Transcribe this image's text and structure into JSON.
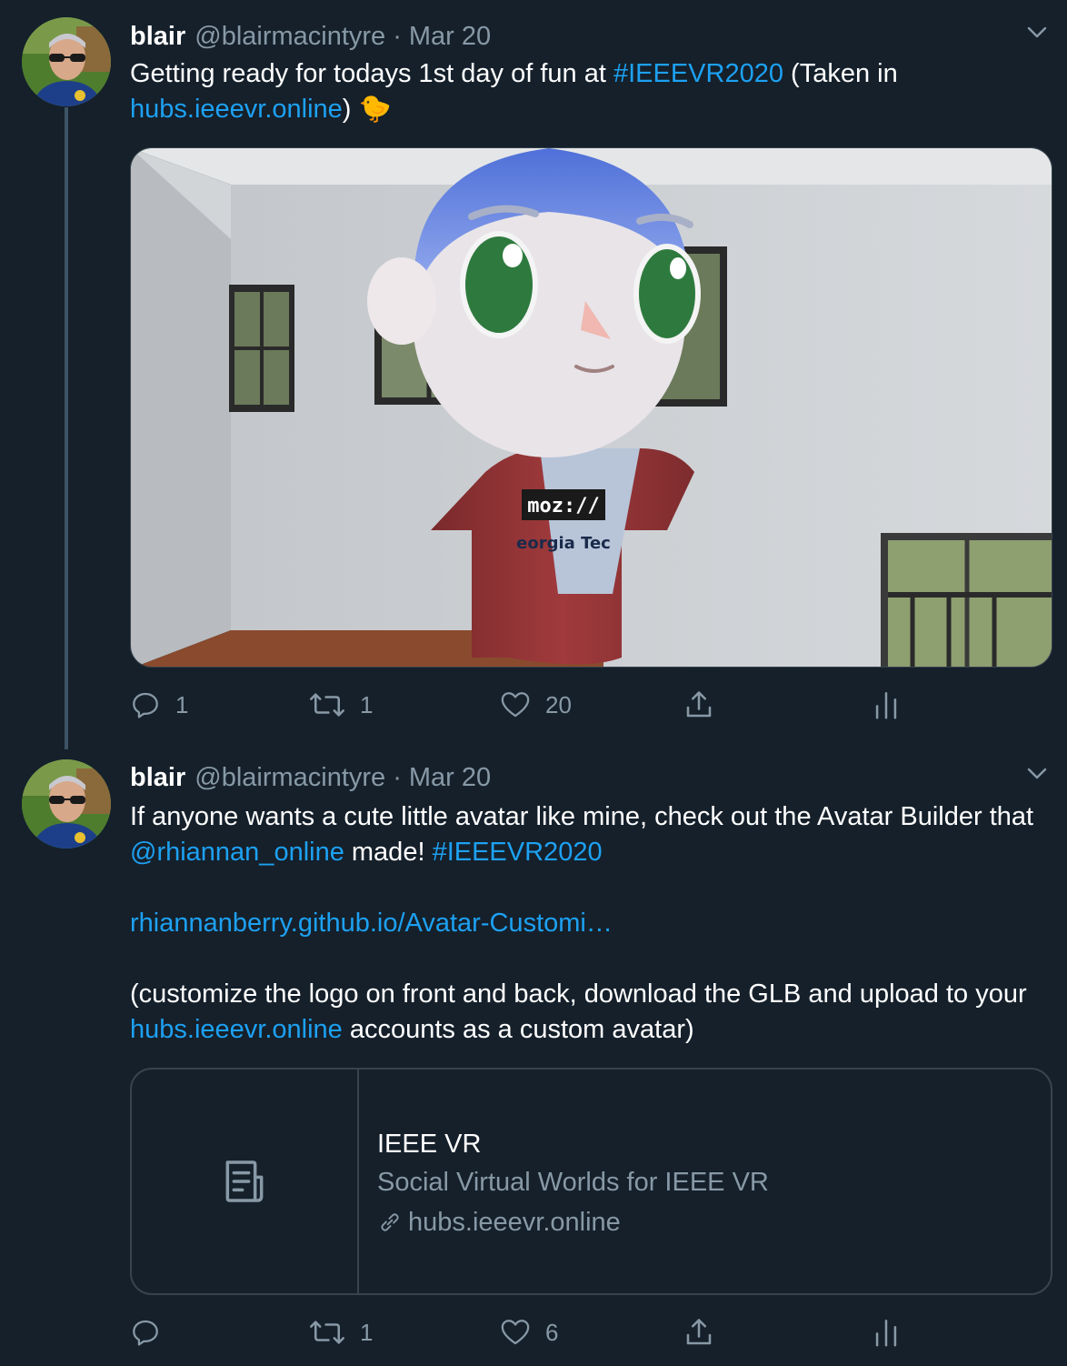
{
  "tweets": [
    {
      "author": {
        "name": "blair",
        "handle": "@blairmacintyre",
        "separator": "·",
        "date": "Mar 20"
      },
      "text": {
        "p1_a": "Getting ready for todays 1st day of fun at ",
        "p1_hashtag": "#IEEEVR2020",
        "p1_b": " (Taken in",
        "p1_link": "hubs.ieeevr.online",
        "p1_c": ") ",
        "emoji": "🐤"
      },
      "media": {
        "shirt_logo_top": "moz://",
        "shirt_logo_bottom": "eorgia Tec"
      },
      "actions": {
        "reply": "1",
        "retweet": "1",
        "like": "20"
      }
    },
    {
      "author": {
        "name": "blair",
        "handle": "@blairmacintyre",
        "separator": "·",
        "date": "Mar 20"
      },
      "text": {
        "p1_a": "If anyone wants a cute little avatar like mine, check out the Avatar Builder that ",
        "p1_mention": "@rhiannan_online",
        "p1_b": " made!  ",
        "p1_hashtag": "#IEEEVR2020",
        "p2_link": "rhiannanberry.github.io/Avatar-Customi…",
        "p3_a": "(customize the logo on front and back, download the GLB and upload to your ",
        "p3_link": "hubs.ieeevr.online",
        "p3_b": " accounts as a custom avatar)"
      },
      "card": {
        "title": "IEEE VR",
        "description": "Social Virtual Worlds for IEEE VR",
        "url": "hubs.ieeevr.online"
      },
      "actions": {
        "reply": "",
        "retweet": "1",
        "like": "6"
      }
    }
  ],
  "colors": {
    "background": "#15202b",
    "link": "#1da1f2",
    "secondary_text": "#8899a6",
    "border": "#38444d"
  },
  "icons": [
    "chevron-down-icon",
    "reply-icon",
    "retweet-icon",
    "like-icon",
    "share-icon",
    "analytics-icon",
    "article-icon",
    "link-icon"
  ]
}
